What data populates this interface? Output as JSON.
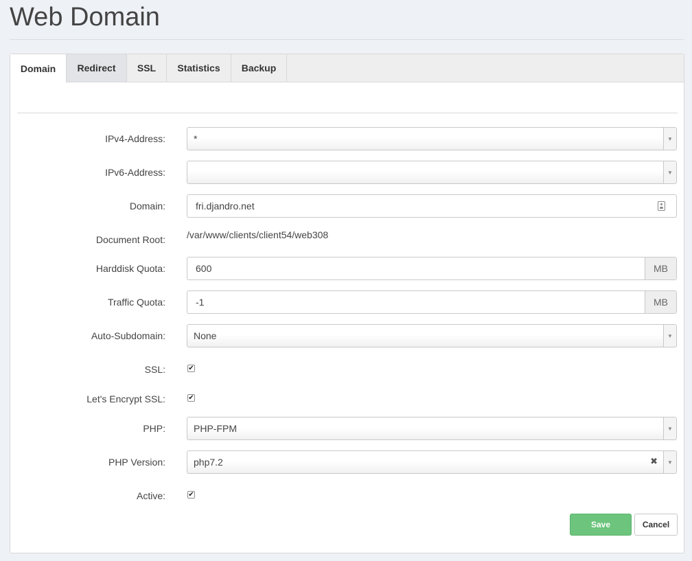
{
  "page": {
    "title": "Web Domain"
  },
  "tabs": [
    {
      "label": "Domain"
    },
    {
      "label": "Redirect"
    },
    {
      "label": "SSL"
    },
    {
      "label": "Statistics"
    },
    {
      "label": "Backup"
    }
  ],
  "form": {
    "ipv4": {
      "label": "IPv4-Address:",
      "value": "*"
    },
    "ipv6": {
      "label": "IPv6-Address:",
      "value": ""
    },
    "domain": {
      "label": "Domain:",
      "value": "fri.djandro.net"
    },
    "document_root": {
      "label": "Document Root:",
      "value": "/var/www/clients/client54/web308"
    },
    "harddisk_quota": {
      "label": "Harddisk Quota:",
      "value": "600",
      "unit": "MB"
    },
    "traffic_quota": {
      "label": "Traffic Quota:",
      "value": "-1",
      "unit": "MB"
    },
    "auto_subdomain": {
      "label": "Auto-Subdomain:",
      "value": "None"
    },
    "ssl": {
      "label": "SSL:",
      "checked": true
    },
    "letsencrypt": {
      "label": "Let's Encrypt SSL:",
      "checked": true
    },
    "php": {
      "label": "PHP:",
      "value": "PHP-FPM"
    },
    "php_version": {
      "label": "PHP Version:",
      "value": "php7.2"
    },
    "active": {
      "label": "Active:",
      "checked": true
    }
  },
  "buttons": {
    "save": "Save",
    "cancel": "Cancel"
  },
  "glyphs": {
    "check": "✔",
    "arrow": "▼",
    "clear": "✖"
  },
  "colors": {
    "save_button": "#6cc47d",
    "page_bg": "#eef1f5"
  }
}
